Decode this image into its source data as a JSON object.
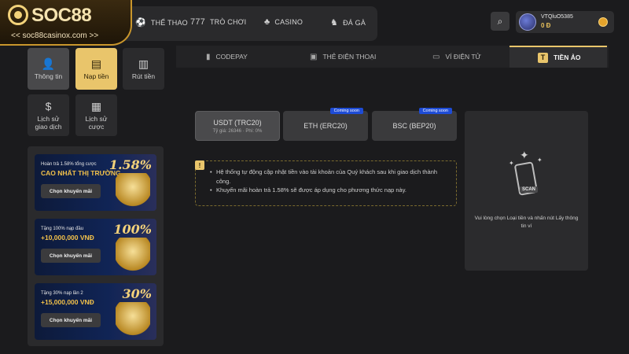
{
  "brand": {
    "name": "SOC88",
    "url": "<< soc88casinox.com >>"
  },
  "nav": [
    {
      "label": "THỂ THAO",
      "icon": "sports-icon"
    },
    {
      "label": "TRÒ CHƠI",
      "icon": "slots-icon"
    },
    {
      "label": "CASINO",
      "icon": "casino-icon"
    },
    {
      "label": "ĐÁ GÀ",
      "icon": "rooster-icon"
    }
  ],
  "user": {
    "name": "VTQluO5385",
    "balance": "0 Đ"
  },
  "sidebar": {
    "items": [
      {
        "label": "Thông tin",
        "icon": "user-info-icon"
      },
      {
        "label": "Nạp tiền",
        "icon": "deposit-icon"
      },
      {
        "label": "Rút tiền",
        "icon": "withdraw-icon"
      },
      {
        "label": "Lịch sử giao dịch",
        "icon": "transaction-history-icon"
      },
      {
        "label": "Lịch sử cược",
        "icon": "bet-history-icon"
      }
    ]
  },
  "promos": [
    {
      "line1": "Hoàn trả 1.58% tổng cược",
      "line2": "CAO NHẤT THỊ TRƯỜNG",
      "pct": "1.58%",
      "cta": "Chọn khuyến mãi"
    },
    {
      "line1": "Tặng 100% nạp đầu",
      "line2": "+10,000,000 VNĐ",
      "pct": "100%",
      "cta": "Chọn khuyến mãi"
    },
    {
      "line1": "Tặng 30% nạp lần 2",
      "line2": "+15,000,000 VNĐ",
      "pct": "30%",
      "cta": "Chọn khuyến mãi"
    }
  ],
  "tabs": [
    {
      "label": "CODEPAY",
      "icon": "codepay-icon"
    },
    {
      "label": "THẺ ĐIỆN THOẠI",
      "icon": "phone-card-icon"
    },
    {
      "label": "VÍ ĐIỆN TỬ",
      "icon": "e-wallet-icon"
    },
    {
      "label": "TIỀN ẢO",
      "icon": "crypto-icon",
      "icon_glyph": "T"
    }
  ],
  "coins": [
    {
      "name": "USDT (TRC20)",
      "sub": "Tỷ giá: 26346 · Phí: 0%",
      "badge": ""
    },
    {
      "name": "ETH (ERC20)",
      "sub": "",
      "badge": "Coming soon"
    },
    {
      "name": "BSC (BEP20)",
      "sub": "",
      "badge": "Coming soon"
    }
  ],
  "notice": {
    "badge": "!",
    "items": [
      "Hệ thống tự động cập nhật tiền vào tài khoản của Quý khách sau khi giao dịch thành công.",
      "Khuyến mãi hoàn trả 1.58% sẽ được áp dụng cho phương thức nạp này."
    ]
  },
  "wallet": {
    "scan_label": "SCAN",
    "message": "Vui lòng chọn Loại tiền và nhấn nút Lấy thông tin ví"
  },
  "colors": {
    "accent": "#e9c56b",
    "background": "#1b1b1d",
    "coming_soon": "#1e4cd6"
  }
}
